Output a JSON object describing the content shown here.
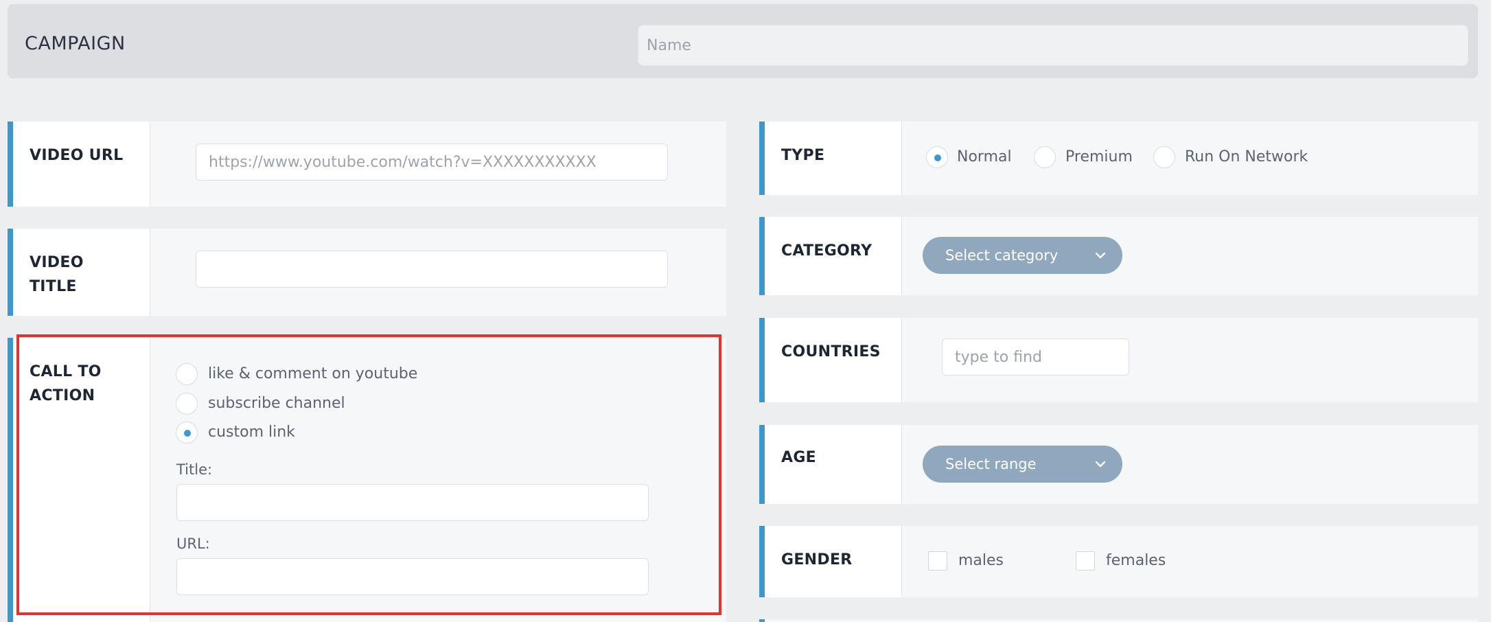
{
  "header": {
    "title": "CAMPAIGN",
    "name_placeholder": "Name"
  },
  "video_url": {
    "label": "VIDEO URL",
    "placeholder": "https://www.youtube.com/watch?v=XXXXXXXXXXX"
  },
  "video_title": {
    "label_line1": "VIDEO",
    "label_line2": "TITLE"
  },
  "call_to_action": {
    "label_line1": "CALL TO",
    "label_line2": "ACTION",
    "options": [
      {
        "label": "like & comment on youtube",
        "checked": false
      },
      {
        "label": "subscribe channel",
        "checked": false
      },
      {
        "label": "custom link",
        "checked": true
      }
    ],
    "title_caption": "Title:",
    "url_caption": "URL:"
  },
  "type": {
    "label": "TYPE",
    "options": [
      {
        "label": "Normal",
        "checked": true
      },
      {
        "label": "Premium",
        "checked": false
      },
      {
        "label": "Run On Network",
        "checked": false
      }
    ]
  },
  "category": {
    "label": "CATEGORY",
    "select_label": "Select category"
  },
  "countries": {
    "label": "COUNTRIES",
    "placeholder": "type to find"
  },
  "age": {
    "label": "AGE",
    "select_label": "Select range"
  },
  "gender": {
    "label": "GENDER",
    "options": [
      "males",
      "females"
    ]
  },
  "colors": {
    "accent": "#3d97cf",
    "select_bg": "#8fa8bd",
    "highlight": "#e6322d"
  }
}
